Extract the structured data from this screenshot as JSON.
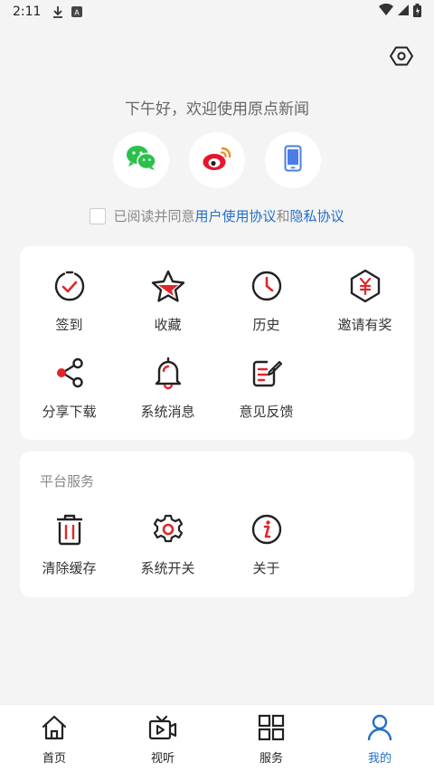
{
  "status_bar": {
    "time": "2:11"
  },
  "greeting": "下午好，欢迎使用原点新闻",
  "login_options": [
    {
      "name": "wechat-login-button",
      "icon": "wechat-icon"
    },
    {
      "name": "weibo-login-button",
      "icon": "weibo-icon"
    },
    {
      "name": "phone-login-button",
      "icon": "phone-icon"
    }
  ],
  "agreement": {
    "prefix": "已阅读并同意",
    "user_agreement": "用户使用协议",
    "conjunction": "和",
    "privacy_policy": "隐私协议"
  },
  "menu": {
    "items": [
      {
        "label": "签到",
        "icon": "checkin-icon"
      },
      {
        "label": "收藏",
        "icon": "star-icon"
      },
      {
        "label": "历史",
        "icon": "clock-icon"
      },
      {
        "label": "邀请有奖",
        "icon": "invite-reward-icon"
      },
      {
        "label": "分享下载",
        "icon": "share-icon"
      },
      {
        "label": "系统消息",
        "icon": "bell-icon"
      },
      {
        "label": "意见反馈",
        "icon": "feedback-icon"
      }
    ]
  },
  "platform": {
    "title": "平台服务",
    "items": [
      {
        "label": "清除缓存",
        "icon": "trash-icon"
      },
      {
        "label": "系统开关",
        "icon": "gear-icon"
      },
      {
        "label": "关于",
        "icon": "info-icon"
      }
    ]
  },
  "tabbar": {
    "tabs": [
      {
        "label": "首页",
        "icon": "home-icon"
      },
      {
        "label": "视听",
        "icon": "video-icon"
      },
      {
        "label": "服务",
        "icon": "grid-icon"
      },
      {
        "label": "我的",
        "icon": "user-icon"
      }
    ],
    "active": "我的"
  },
  "colors": {
    "accent": "#1f6fc9",
    "red": "#e0262b",
    "dark": "#222222"
  }
}
